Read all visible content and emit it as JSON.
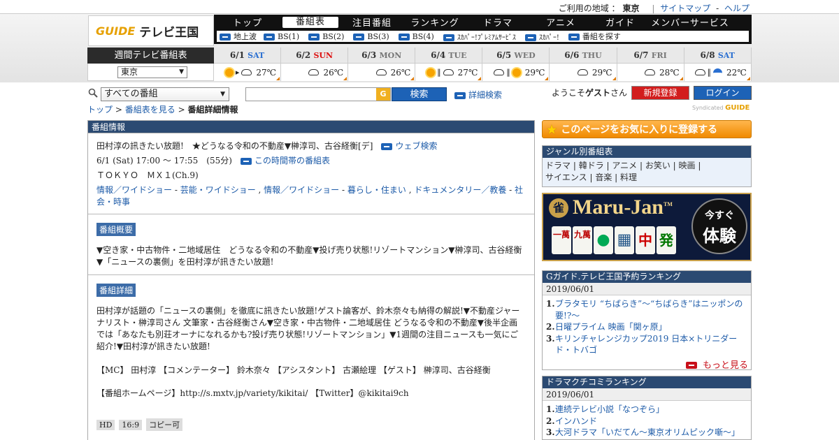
{
  "util": {
    "region_label": "ご利用の地域 ：",
    "region_value": "東京",
    "sitemap": "サイトマップ",
    "dash": "-",
    "help": "ヘルプ"
  },
  "logo": {
    "brand": "GUIDE",
    "title": "テレビ王国"
  },
  "gnav": [
    "トップ",
    "番組表",
    "注目番組",
    "ランキング",
    "ドラマ",
    "アニメ",
    "ガイド",
    "メンバーサービス"
  ],
  "subnav": [
    "地上波",
    "BS(1)",
    "BS(2)",
    "BS(3)",
    "BS(4)",
    "ｽｶﾊﾟｰ!ﾌﾟﾚﾐｱﾑｻｰﾋﾞｽ",
    "ｽｶﾊﾟｰ!",
    "番組を探す"
  ],
  "datebar": {
    "title": "週間テレビ番組表",
    "region": "東京"
  },
  "days": [
    {
      "date": "6/1",
      "wd": "SAT",
      "temp": "27℃",
      "wx": [
        "sun",
        "arrow",
        "cloud"
      ]
    },
    {
      "date": "6/2",
      "wd": "SUN",
      "temp": "26℃",
      "wx": [
        "cloud"
      ]
    },
    {
      "date": "6/3",
      "wd": "MON",
      "temp": "26℃",
      "wx": [
        "cloud"
      ]
    },
    {
      "date": "6/4",
      "wd": "TUE",
      "temp": "27℃",
      "wx": [
        "sun",
        "bar",
        "cloud"
      ]
    },
    {
      "date": "6/5",
      "wd": "WED",
      "temp": "29℃",
      "wx": [
        "cloud",
        "bar",
        "sun"
      ]
    },
    {
      "date": "6/6",
      "wd": "THU",
      "temp": "29℃",
      "wx": [
        "cloud"
      ]
    },
    {
      "date": "6/7",
      "wd": "FRI",
      "temp": "28℃",
      "wx": [
        "cloud"
      ]
    },
    {
      "date": "6/8",
      "wd": "SAT",
      "temp": "22℃",
      "wx": [
        "cloud",
        "bar",
        "umbrella"
      ]
    }
  ],
  "search": {
    "category": "すべての番組",
    "button": "検索",
    "advanced": "詳細検索",
    "logo": "G"
  },
  "breadcrumb": {
    "top": "トップ",
    "sep": ">",
    "guide": "番組表を見る",
    "current": "番組詳細情報"
  },
  "user": {
    "welcome_pre": "ようこそ",
    "guest": "ゲスト",
    "welcome_post": "さん",
    "register": "新規登録",
    "login": "ログイン",
    "synd_pre": "Syndicated",
    "synd_logo": "GUIDE"
  },
  "program": {
    "header": "番組情報",
    "title": "田村淳の訊きたい放題!　★どうなる令和の不動産▼榊淳司、古谷経衡[デ]",
    "web_search": "ウェブ検索",
    "time": "6/1 (Sat) 17:00 ～ 17:55　(55分)",
    "timeslot": "この時間帯の番組表",
    "channel": "ＴＯＫＹＯ　ＭＸ１(Ch.9)",
    "genres": [
      {
        "a": "情報／ワイドショー",
        "b": "芸能・ワイドショー"
      },
      {
        "a": "情報／ワイドショー",
        "b": "暮らし・住まい"
      },
      {
        "a": "ドキュメンタリー／教養",
        "b": "社会・時事"
      }
    ],
    "genre_dash": " - ",
    "genre_comma": " , ",
    "summary_tag": "番組概要",
    "summary": "▼空き家・中古物件・二地域居住　どうなる令和の不動産▼投げ売り状態!リゾートマンション▼榊淳司、古谷経衡▼「ニュースの裏側」を田村淳が訊きたい放題!",
    "detail_tag": "番組詳細",
    "detail": "田村淳が話題の「ニュースの裏側」を徹底に訊きたい放題!ゲスト論客が、鈴木奈々も納得の解説!▼不動産ジャーナリスト・榊淳司さん 文筆家・古谷経衡さん▼空き家・中古物件・二地域居住 どうなる令和の不動産▼後半企画では「あなたも別荘オーナになれるかも?投げ売り状態!リゾートマンション」▼1週間の注目ニュースも一気にご紹介!▼田村淳が訊きたい放題!",
    "cast": "【MC】 田村淳 【コメンテーター】 鈴木奈々 【アシスタント】 古瀬絵理 【ゲスト】 榊淳司、古谷経衡",
    "hp": "【番組ホームページ】http://s.mxtv.jp/variety/kikitai/ 【Twitter】@kikitai9ch",
    "labels": [
      "HD",
      "16:9",
      "コピー可"
    ]
  },
  "right": {
    "fav": "このページをお気に入りに登録する",
    "genre_head": "ジャンル別番組表",
    "genres": [
      "ドラマ",
      "韓ドラ",
      "アニメ",
      "お笑い",
      "映画",
      "サイエンス",
      "音楽",
      "料理"
    ],
    "genre_sep": " | ",
    "ad": {
      "brand": "Maru-Jan",
      "tm": "TM",
      "cta1": "今すぐ",
      "cta2": "体験",
      "tiles": [
        "一萬",
        "九萬",
        "●",
        "▦",
        "中",
        "発"
      ]
    },
    "rank1": {
      "head": "Gガイド.テレビ王国予約ランキング",
      "date": "2019/06/01",
      "items": [
        "ブラタモリ “ちばらき”〜“ちばらき”はニッポンの要!?〜",
        "日曜プライム 映画「関ヶ原」",
        "キリンチャレンジカップ2019 日本×トリニダード・トバゴ"
      ],
      "more": "もっと見る"
    },
    "rank2": {
      "head": "ドラマクチコミランキング",
      "date": "2019/06/01",
      "items": [
        "連続テレビ小説「なつぞら」",
        "インハンド",
        "大河ドラマ「いだてん～東京オリムピック噺～」"
      ]
    }
  }
}
